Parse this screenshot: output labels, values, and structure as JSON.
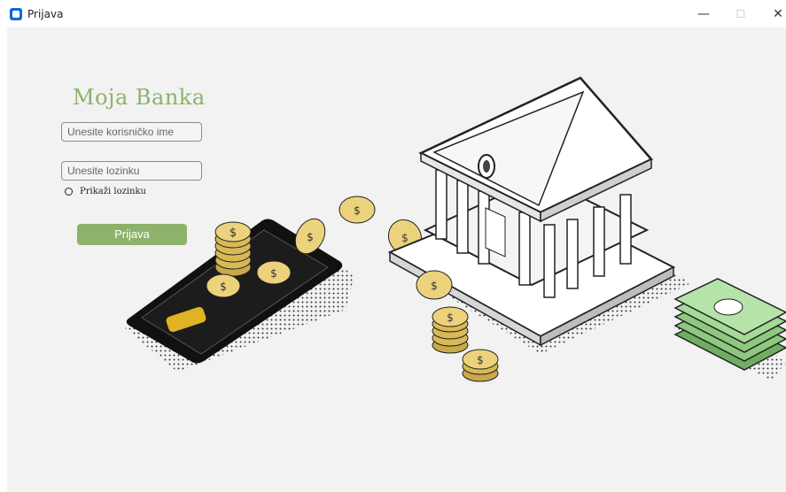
{
  "window": {
    "title": "Prijava",
    "controls": {
      "minimize": "—",
      "maximize": "☐",
      "close": "✕"
    }
  },
  "brand": {
    "name": "Moja Banka",
    "color": "#8db26a"
  },
  "form": {
    "username_placeholder": "Unesite korisničko ime",
    "password_placeholder": "Unesite lozinku",
    "show_password_label": "Prikaži lozinku",
    "submit_label": "Prijava"
  },
  "illustration": {
    "description_icons": [
      "phone-icon",
      "coin-icon",
      "bank-building-icon",
      "banknote-stack-icon"
    ]
  },
  "colors": {
    "accent": "#8db26a",
    "background": "#f2f2f2",
    "coin": "#e3c35a",
    "money": "#9fd38f"
  }
}
